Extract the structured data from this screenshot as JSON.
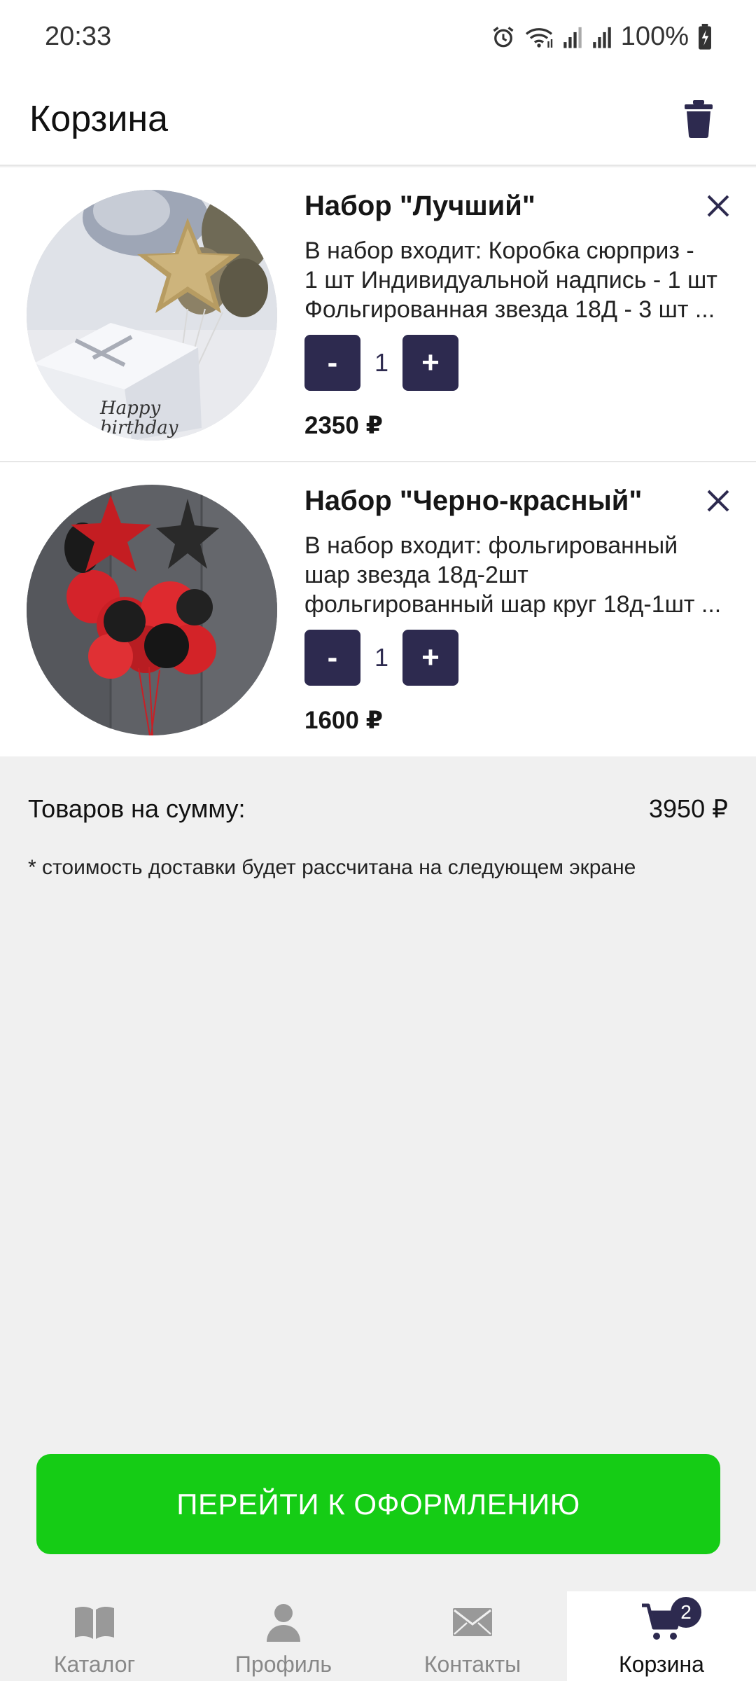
{
  "status_bar": {
    "time": "20:33",
    "battery": "100%",
    "icons": [
      "alarm-icon",
      "wifi-icon",
      "signal-icon",
      "signal-icon",
      "battery-charging-icon"
    ]
  },
  "header": {
    "title": "Корзина",
    "trash_icon": "trash-icon"
  },
  "cart": {
    "items": [
      {
        "title": "Набор \"Лучший\"",
        "desc_lines": [
          "В набор входит: Коробка сюрприз -",
          "1 шт Индивидуальной надпись - 1 шт",
          "Фольгированная звезда 18Д - 3 шт ..."
        ],
        "minus": "-",
        "plus": "+",
        "quantity": "1",
        "price": "2350 ₽"
      },
      {
        "title": "Набор \"Черно-красный\"",
        "desc_lines": [
          "В набор входит: фольгированный",
          "шар звезда 18д-2шт",
          "фольгированный шар круг 18д-1шт ..."
        ],
        "minus": "-",
        "plus": "+",
        "quantity": "1",
        "price": "1600 ₽"
      }
    ]
  },
  "summary": {
    "label": "Товаров на сумму:",
    "total": "3950 ₽",
    "delivery_note": "* стоимость доставки будет рассчитана на следующем экране"
  },
  "checkout": {
    "label": "ПЕРЕЙТИ К ОФОРМЛЕНИЮ",
    "color": "#15cc15"
  },
  "bottom_nav": {
    "items": [
      {
        "label": "Каталог",
        "icon": "book-icon"
      },
      {
        "label": "Профиль",
        "icon": "person-icon"
      },
      {
        "label": "Контакты",
        "icon": "envelope-icon"
      },
      {
        "label": "Корзина",
        "icon": "cart-icon",
        "badge": "2",
        "active": true
      }
    ]
  },
  "colors": {
    "accent": "#2d2a4f",
    "background": "#f0f0f0"
  }
}
